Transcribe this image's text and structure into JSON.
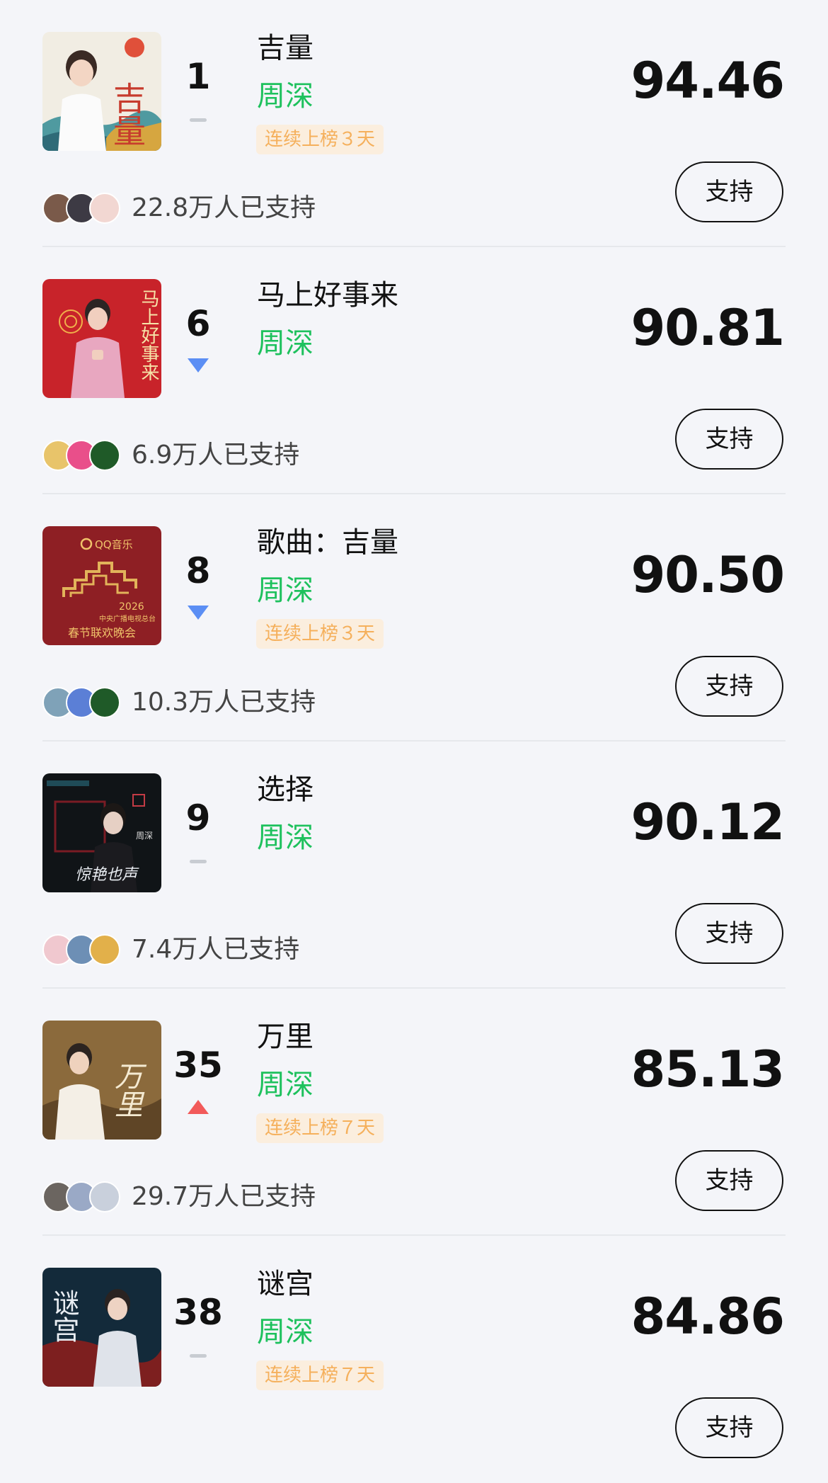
{
  "songs": [
    {
      "rank": "1",
      "trend": "flat",
      "title": "吉量",
      "artist": "周深",
      "streak": "连续上榜３天",
      "score": "94.46",
      "support_label": "支持",
      "supporters": "22.8万人已支持",
      "cover_icon": "cover-jiliang-icon",
      "avatar_colors": [
        "#7a5a4a",
        "#3d3a44",
        "#f2d7d2"
      ]
    },
    {
      "rank": "6",
      "trend": "down",
      "title": "马上好事来",
      "artist": "周深",
      "streak": "",
      "score": "90.81",
      "support_label": "支持",
      "supporters": "6.9万人已支持",
      "cover_icon": "cover-mashanghaoshilai-icon",
      "avatar_colors": [
        "#e8c46a",
        "#e94f8a",
        "#1f5a28"
      ]
    },
    {
      "rank": "8",
      "trend": "down",
      "title": "歌曲：吉量",
      "artist": "周深",
      "streak": "连续上榜３天",
      "score": "90.50",
      "support_label": "支持",
      "supporters": "10.3万人已支持",
      "cover_icon": "cover-gala-icon",
      "avatar_colors": [
        "#7fa2b8",
        "#5b7fd6",
        "#1f5a28"
      ]
    },
    {
      "rank": "9",
      "trend": "flat",
      "title": "选择",
      "artist": "周深",
      "streak": "",
      "score": "90.12",
      "support_label": "支持",
      "supporters": "7.4万人已支持",
      "cover_icon": "cover-xuanze-icon",
      "avatar_colors": [
        "#f0c8cf",
        "#6d8fb5",
        "#e2b04a"
      ]
    },
    {
      "rank": "35",
      "trend": "up",
      "title": "万里",
      "artist": "周深",
      "streak": "连续上榜７天",
      "score": "85.13",
      "support_label": "支持",
      "supporters": "29.7万人已支持",
      "cover_icon": "cover-wanli-icon",
      "avatar_colors": [
        "#6b6560",
        "#9aa9c6",
        "#c9d0dc"
      ]
    },
    {
      "rank": "38",
      "trend": "flat",
      "title": "谜宫",
      "artist": "周深",
      "streak": "连续上榜７天",
      "score": "84.86",
      "support_label": "支持",
      "supporters": "",
      "cover_icon": "cover-migong-icon",
      "avatar_colors": []
    }
  ],
  "colors": {
    "background": "#f4f5f9",
    "artist": "#1ec15d",
    "streak_text": "#f5b05c",
    "streak_bg": "#fbeede",
    "trend_down": "#5b8ef4",
    "trend_up": "#f25a5a"
  },
  "cover_text": {
    "jiliang": "吉量",
    "mashanghaoshilai": "马上好事来",
    "gala_brand": "QQ音乐",
    "gala_year": "2026",
    "gala_sub": "中央广播电视总台",
    "gala_name": "春节联欢晚会",
    "xuanze_artist": "周深",
    "xuanze_show": "惊艳也声",
    "wanli": "万里",
    "migong": "谜宫"
  }
}
